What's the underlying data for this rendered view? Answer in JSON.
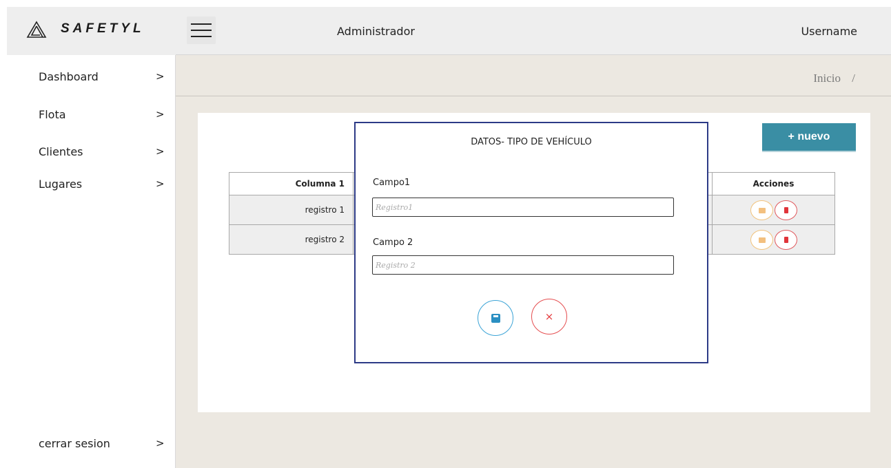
{
  "app": {
    "logo_text": "SAFETYL",
    "role": "Administrador",
    "username": "Username"
  },
  "sidebar": {
    "items": [
      {
        "label": "Dashboard",
        "chevron": ">"
      },
      {
        "label": "Flota",
        "chevron": ">"
      },
      {
        "label": "Clientes",
        "chevron": ">"
      },
      {
        "label": "Lugares",
        "chevron": ">"
      }
    ],
    "logout": {
      "label": "cerrar sesion",
      "chevron": ">"
    }
  },
  "breadcrumb": {
    "current": "Inicio",
    "separator": "/"
  },
  "toolbar": {
    "new_label": "+ nuevo"
  },
  "table": {
    "headers": {
      "col1": "Columna 1",
      "actions": "Acciones"
    },
    "rows": [
      {
        "col1": "registro 1"
      },
      {
        "col1": "registro 2"
      }
    ]
  },
  "modal": {
    "title": "DATOS- TIPO DE VEHÍCULO",
    "field1": {
      "label": "Campo1",
      "placeholder": "Registro1"
    },
    "field2": {
      "label": "Campo 2",
      "placeholder": "Registro 2"
    },
    "cancel_symbol": "×"
  },
  "colors": {
    "accent": "#3a8ea4",
    "modal_border": "#2c3a86",
    "save": "#3aa3d6",
    "danger": "#e54d4f",
    "edit": "#f2c27a"
  },
  "icons": {
    "logo": "logo-icon",
    "menu": "hamburger-icon",
    "save": "save-icon",
    "cancel": "close-icon",
    "edit": "edit-icon",
    "delete": "trash-icon"
  }
}
